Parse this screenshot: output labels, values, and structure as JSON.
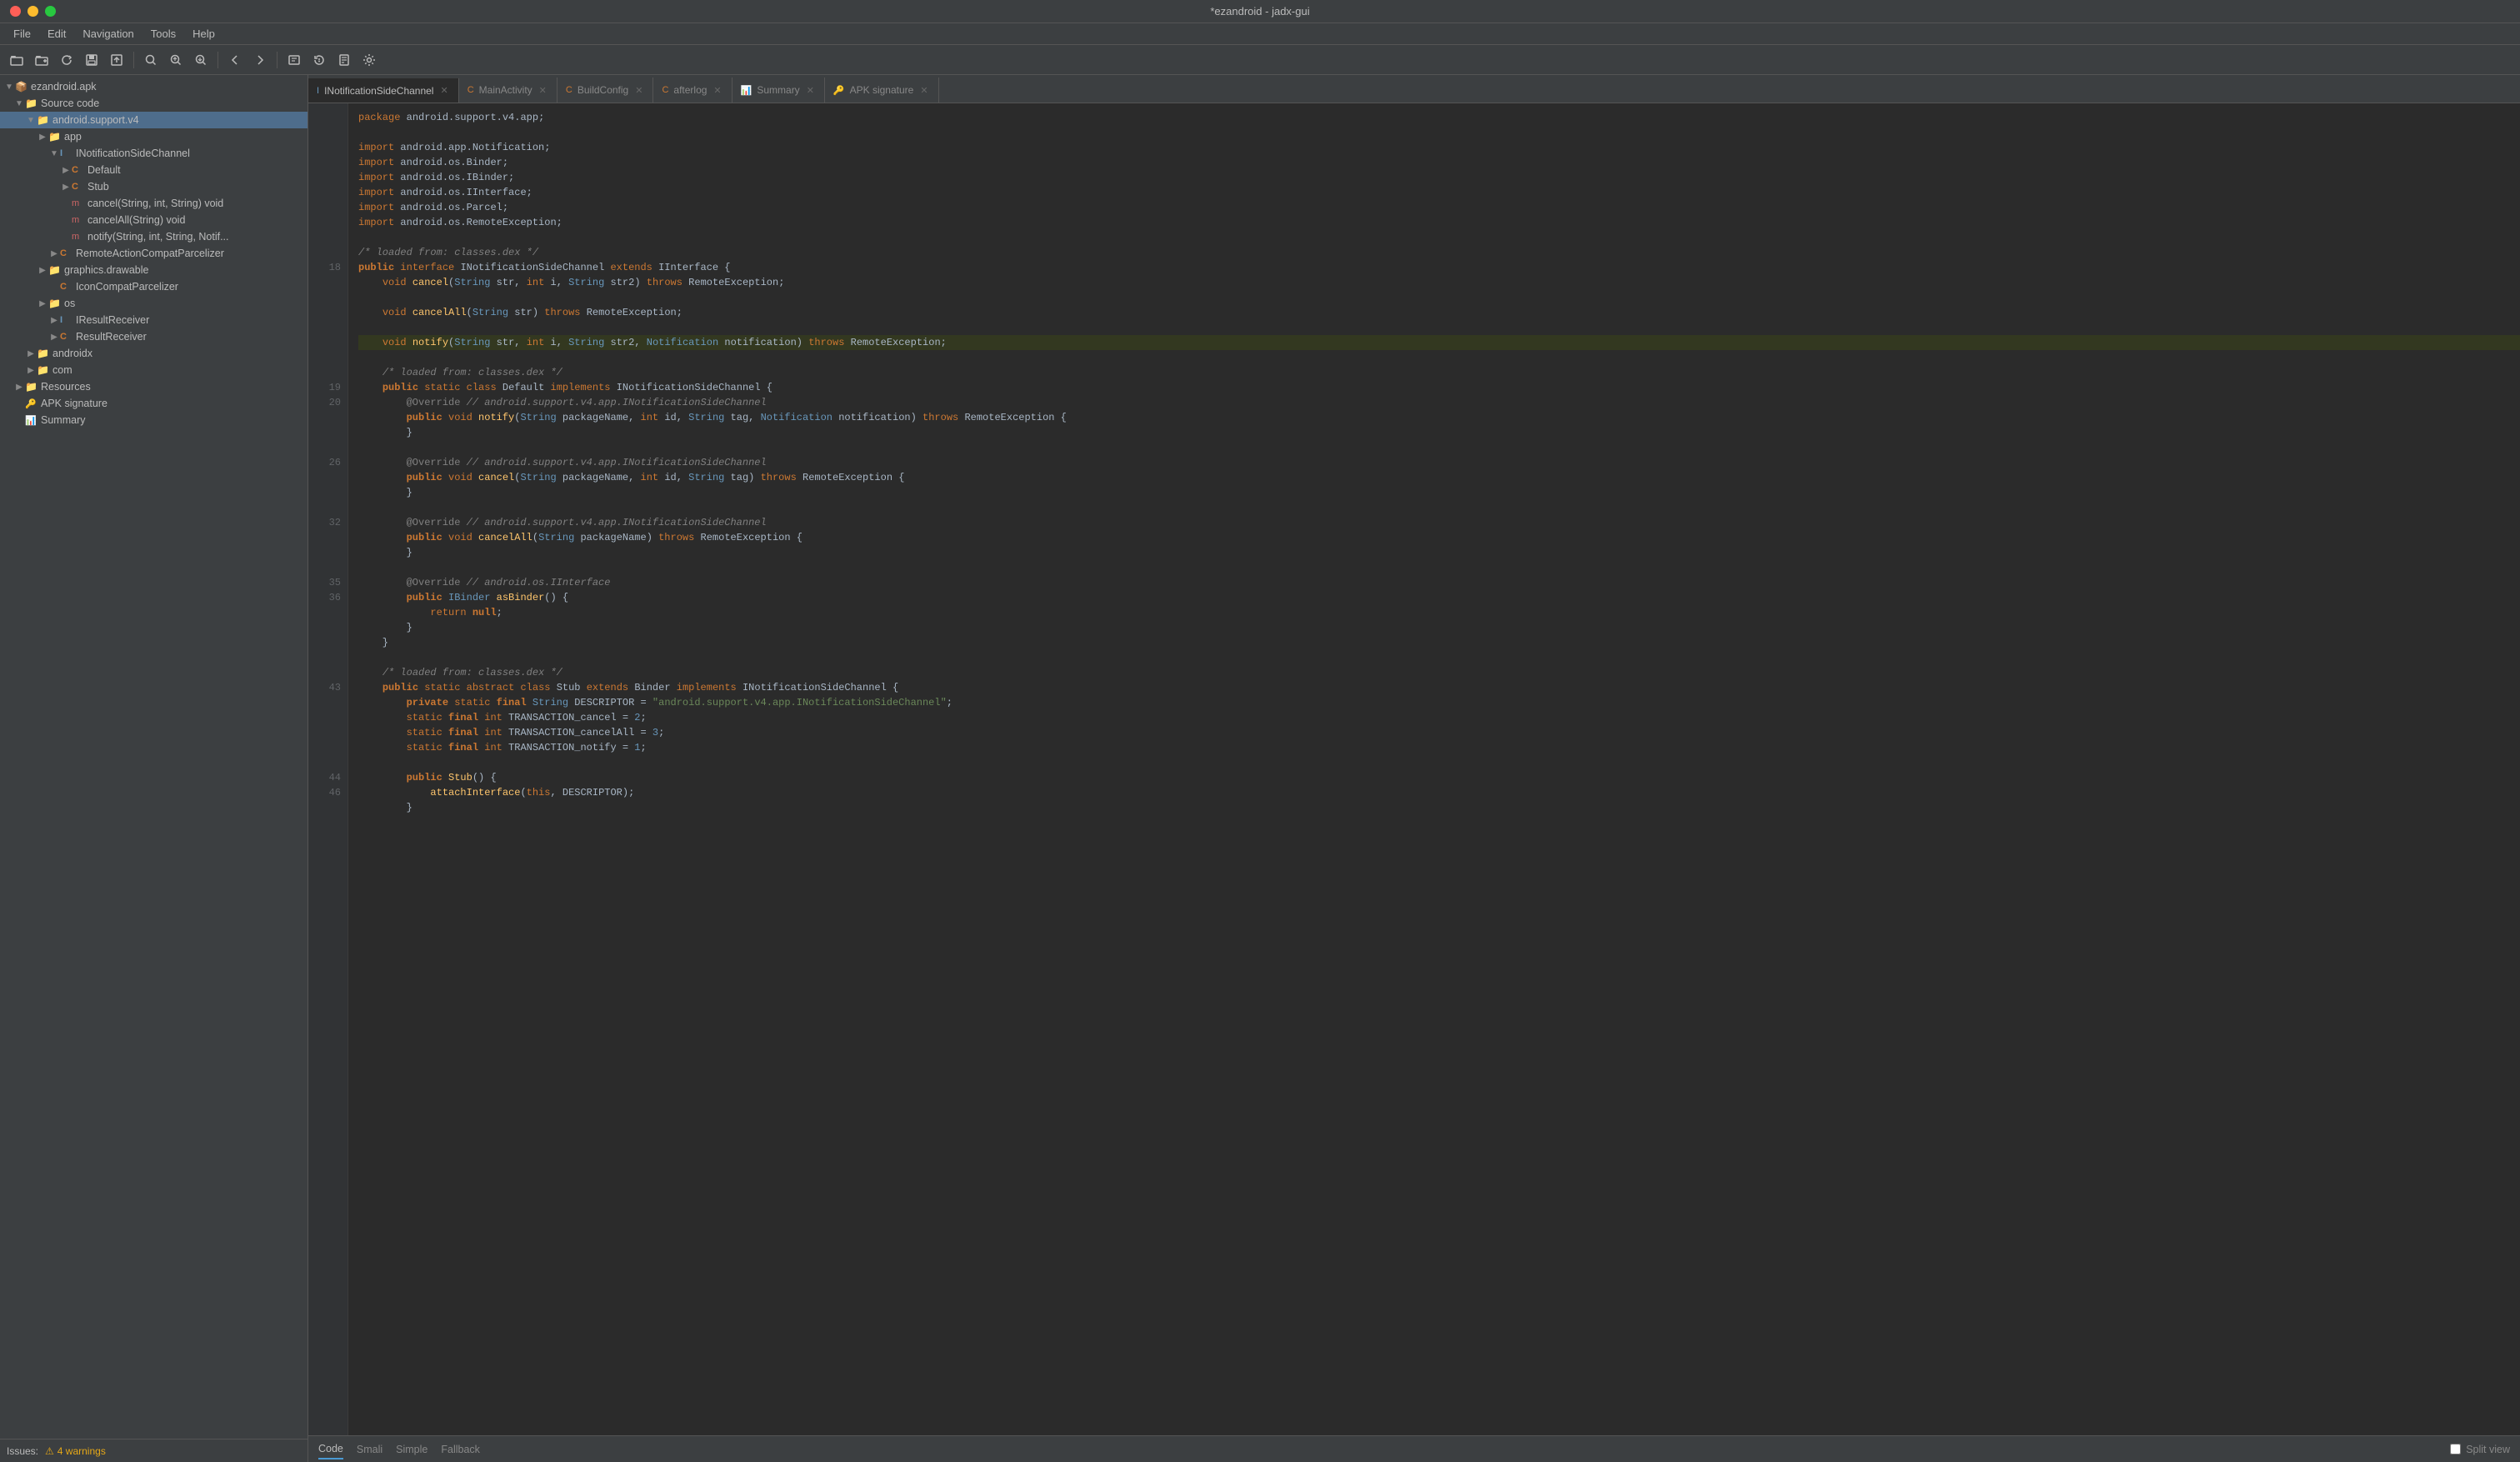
{
  "window": {
    "title": "*ezandroid - jadx-gui"
  },
  "menu": {
    "items": [
      "File",
      "Edit",
      "Navigation",
      "Tools",
      "Help"
    ]
  },
  "toolbar": {
    "buttons": [
      "open",
      "add",
      "refresh",
      "save",
      "export",
      "separator",
      "find",
      "find-prev",
      "find-next",
      "separator",
      "back",
      "forward",
      "separator",
      "decompile",
      "sync",
      "smali",
      "settings"
    ]
  },
  "sidebar": {
    "items": [
      {
        "id": "apk",
        "label": "ezandroid.apk",
        "indent": 0,
        "type": "apk",
        "arrow": "",
        "expanded": true
      },
      {
        "id": "source-code",
        "label": "Source code",
        "indent": 1,
        "type": "folder",
        "arrow": "▼",
        "expanded": true
      },
      {
        "id": "android-support",
        "label": "android.support.v4",
        "indent": 2,
        "type": "folder",
        "arrow": "▼",
        "expanded": true,
        "selected": true
      },
      {
        "id": "app",
        "label": "app",
        "indent": 3,
        "type": "folder",
        "arrow": "▶",
        "expanded": true
      },
      {
        "id": "INotificationSideChannel",
        "label": "INotificationSideChannel",
        "indent": 4,
        "type": "interface",
        "arrow": "▼",
        "expanded": true
      },
      {
        "id": "Default",
        "label": "Default",
        "indent": 5,
        "type": "class",
        "arrow": "▶"
      },
      {
        "id": "Stub",
        "label": "Stub",
        "indent": 5,
        "type": "class",
        "arrow": "▶"
      },
      {
        "id": "cancel",
        "label": "cancel(String, int, String) void",
        "indent": 5,
        "type": "method-red"
      },
      {
        "id": "cancelAll",
        "label": "cancelAll(String) void",
        "indent": 5,
        "type": "method-red"
      },
      {
        "id": "notify",
        "label": "notify(String, int, String, Notif...",
        "indent": 5,
        "type": "method-red"
      },
      {
        "id": "RemoteActionCompatParcelizer",
        "label": "RemoteActionCompatParcelizer",
        "indent": 4,
        "type": "class",
        "arrow": "▶"
      },
      {
        "id": "graphics-drawable",
        "label": "graphics.drawable",
        "indent": 3,
        "type": "folder",
        "arrow": "▶"
      },
      {
        "id": "IconCompatParcelizer",
        "label": "IconCompatParcelizer",
        "indent": 4,
        "type": "class"
      },
      {
        "id": "os",
        "label": "os",
        "indent": 3,
        "type": "folder",
        "arrow": "▶"
      },
      {
        "id": "IResultReceiver",
        "label": "IResultReceiver",
        "indent": 4,
        "type": "interface",
        "arrow": "▶"
      },
      {
        "id": "ResultReceiver",
        "label": "ResultReceiver",
        "indent": 4,
        "type": "class",
        "arrow": "▶"
      },
      {
        "id": "androidx",
        "label": "androidx",
        "indent": 2,
        "type": "folder",
        "arrow": "▶"
      },
      {
        "id": "com",
        "label": "com",
        "indent": 2,
        "type": "folder",
        "arrow": "▶"
      },
      {
        "id": "Resources",
        "label": "Resources",
        "indent": 1,
        "type": "folder",
        "arrow": "▶"
      },
      {
        "id": "APK-signature",
        "label": "APK signature",
        "indent": 1,
        "type": "apk-sig"
      },
      {
        "id": "Summary",
        "label": "Summary",
        "indent": 1,
        "type": "summary"
      }
    ]
  },
  "tabs": [
    {
      "id": "INotificationSideChannel",
      "label": "INotificationSideChannel",
      "icon": "interface",
      "active": true,
      "closable": true
    },
    {
      "id": "MainActivity",
      "label": "MainActivity",
      "icon": "class",
      "active": false,
      "closable": true
    },
    {
      "id": "BuildConfig",
      "label": "BuildConfig",
      "icon": "class",
      "active": false,
      "closable": true
    },
    {
      "id": "afterlog",
      "label": "afterlog",
      "icon": "class",
      "active": false,
      "closable": true
    },
    {
      "id": "Summary",
      "label": "Summary",
      "icon": "summary",
      "active": false,
      "closable": true
    },
    {
      "id": "APK-signature",
      "label": "APK signature",
      "icon": "apk-sig",
      "active": false,
      "closable": true
    }
  ],
  "code": {
    "lines": [
      {
        "num": "",
        "text": "package android.support.v4.app;"
      },
      {
        "num": "",
        "text": ""
      },
      {
        "num": "",
        "text": "import android.app.Notification;"
      },
      {
        "num": "",
        "text": "import android.os.Binder;"
      },
      {
        "num": "",
        "text": "import android.os.IBinder;"
      },
      {
        "num": "",
        "text": "import android.os.IInterface;"
      },
      {
        "num": "",
        "text": "import android.os.Parcel;"
      },
      {
        "num": "",
        "text": "import android.os.RemoteException;"
      },
      {
        "num": "",
        "text": ""
      },
      {
        "num": "",
        "text": "/* loaded from: classes.dex */"
      },
      {
        "num": "18",
        "text": "public interface INotificationSideChannel extends IInterface {",
        "highlight": false
      },
      {
        "num": "",
        "text": "    void cancel(String str, int i, String str2) throws RemoteException;"
      },
      {
        "num": "",
        "text": ""
      },
      {
        "num": "",
        "text": "    void cancelAll(String str) throws RemoteException;"
      },
      {
        "num": "",
        "text": ""
      },
      {
        "num": "",
        "text": "    void notify(String str, int i, String str2, Notification notification) throws RemoteException;",
        "highlight": true
      },
      {
        "num": "",
        "text": ""
      },
      {
        "num": "",
        "text": "    /* loaded from: classes.dex */"
      },
      {
        "num": "19",
        "text": "    public static class Default implements INotificationSideChannel {"
      },
      {
        "num": "20",
        "text": "        @Override // android.support.v4.app.INotificationSideChannel"
      },
      {
        "num": "",
        "text": "        public void notify(String packageName, int id, String tag, Notification notification) throws RemoteException {"
      },
      {
        "num": "",
        "text": "        }"
      },
      {
        "num": "",
        "text": ""
      },
      {
        "num": "26",
        "text": "        @Override // android.support.v4.app.INotificationSideChannel"
      },
      {
        "num": "",
        "text": "        public void cancel(String packageName, int id, String tag) throws RemoteException {"
      },
      {
        "num": "",
        "text": "        }"
      },
      {
        "num": "",
        "text": ""
      },
      {
        "num": "32",
        "text": "        @Override // android.support.v4.app.INotificationSideChannel"
      },
      {
        "num": "",
        "text": "        public void cancelAll(String packageName) throws RemoteException {"
      },
      {
        "num": "",
        "text": "        }"
      },
      {
        "num": "",
        "text": ""
      },
      {
        "num": "35",
        "text": "        @Override // android.os.IInterface"
      },
      {
        "num": "36",
        "text": "        public IBinder asBinder() {"
      },
      {
        "num": "",
        "text": "            return null;"
      },
      {
        "num": "",
        "text": "        }"
      },
      {
        "num": "",
        "text": "    }"
      },
      {
        "num": "",
        "text": ""
      },
      {
        "num": "",
        "text": "    /* loaded from: classes.dex */"
      },
      {
        "num": "43",
        "text": "    public static abstract class Stub extends Binder implements INotificationSideChannel {"
      },
      {
        "num": "",
        "text": "        private static final String DESCRIPTOR = \"android.support.v4.app.INotificationSideChannel\";"
      },
      {
        "num": "",
        "text": "        static final int TRANSACTION_cancel = 2;"
      },
      {
        "num": "",
        "text": "        static final int TRANSACTION_cancelAll = 3;"
      },
      {
        "num": "",
        "text": "        static final int TRANSACTION_notify = 1;"
      },
      {
        "num": "",
        "text": ""
      },
      {
        "num": "44",
        "text": "        public Stub() {"
      },
      {
        "num": "46",
        "text": "            attachInterface(this, DESCRIPTOR);"
      },
      {
        "num": "",
        "text": "        }"
      }
    ]
  },
  "bottom_tabs": {
    "tabs": [
      "Code",
      "Smali",
      "Simple",
      "Fallback"
    ],
    "active": "Code",
    "split_view_label": "Split view"
  },
  "issues": {
    "label": "Issues:",
    "warnings": "4 warnings"
  }
}
